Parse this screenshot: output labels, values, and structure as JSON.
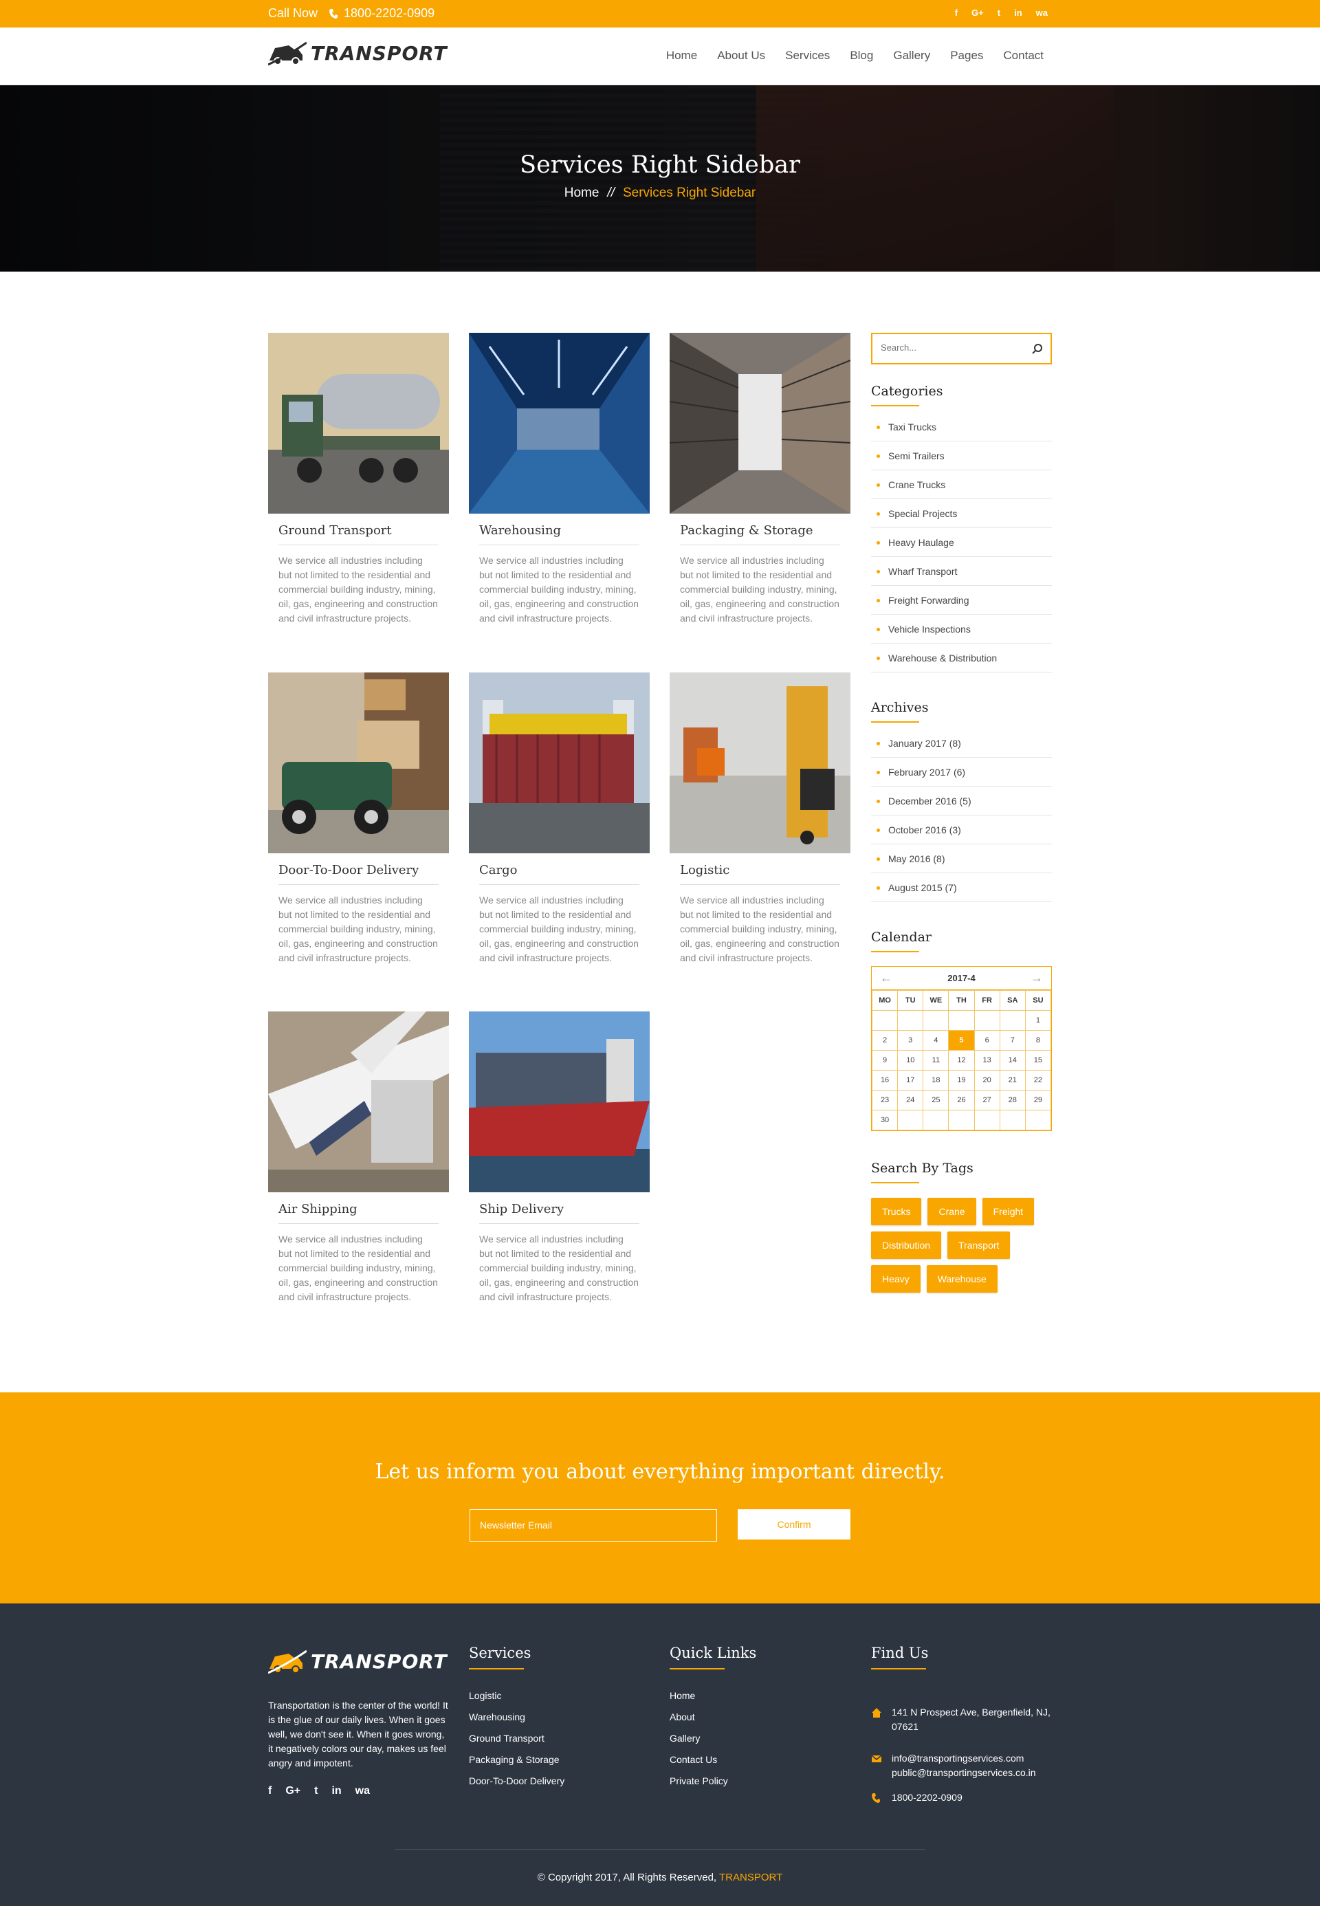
{
  "topbar": {
    "call_label": "Call Now",
    "phone": "1800-2202-0909",
    "socials": [
      "f",
      "G+",
      "t",
      "in",
      "wa"
    ]
  },
  "header": {
    "logo_text": "TRANSPORT",
    "nav": [
      "Home",
      "About Us",
      "Services",
      "Blog",
      "Gallery",
      "Pages",
      "Contact"
    ]
  },
  "hero": {
    "title": "Services Right Sidebar",
    "crumb_home": "Home",
    "crumb_sep": "//",
    "crumb_current": "Services Right Sidebar"
  },
  "services": [
    {
      "title": "Ground Transport",
      "text": "We service all industries including but not limited to the residential and commercial building industry, mining, oil, gas, engineering and construction and civil infrastructure projects."
    },
    {
      "title": "Warehousing",
      "text": "We service all industries including but not limited to the residential and commercial building industry, mining, oil, gas, engineering and construction and civil infrastructure projects."
    },
    {
      "title": "Packaging & Storage",
      "text": "We service all industries including but not limited to the residential and commercial building industry, mining, oil, gas, engineering and construction and civil infrastructure projects."
    },
    {
      "title": "Door-To-Door Delivery",
      "text": "We service all industries including but not limited to the residential and commercial building industry, mining, oil, gas, engineering and construction and civil infrastructure projects."
    },
    {
      "title": "Cargo",
      "text": "We service all industries including but not limited to the residential and commercial building industry, mining, oil, gas, engineering and construction and civil infrastructure projects."
    },
    {
      "title": "Logistic",
      "text": "We service all industries including but not limited to the residential and commercial building industry, mining, oil, gas, engineering and construction and civil infrastructure projects."
    },
    {
      "title": "Air Shipping",
      "text": "We service all industries including but not limited to the residential and commercial building industry, mining, oil, gas, engineering and construction and civil infrastructure projects."
    },
    {
      "title": "Ship Delivery",
      "text": "We service all industries including but not limited to the residential and commercial building industry, mining, oil, gas, engineering and construction and civil infrastructure projects."
    }
  ],
  "sidebar": {
    "search_placeholder": "Search...",
    "categories_title": "Categories",
    "categories": [
      "Taxi Trucks",
      "Semi Trailers",
      "Crane Trucks",
      "Special Projects",
      "Heavy Haulage",
      "Wharf Transport",
      "Freight Forwarding",
      "Vehicle Inspections",
      "Warehouse & Distribution"
    ],
    "archives_title": "Archives",
    "archives": [
      "January 2017 (8)",
      "February 2017 (6)",
      "December 2016 (5)",
      "October 2016 (3)",
      "May 2016 (8)",
      "August 2015 (7)"
    ],
    "calendar_title": "Calendar",
    "calendar": {
      "month": "2017-4",
      "prev": "←",
      "next": "→",
      "days": [
        "MO",
        "TU",
        "WE",
        "TH",
        "FR",
        "SA",
        "SU"
      ],
      "today": "5",
      "weeks": [
        [
          "",
          "",
          "",
          "",
          "",
          "",
          "1"
        ],
        [
          "2",
          "3",
          "4",
          "5",
          "6",
          "7",
          "8"
        ],
        [
          "9",
          "10",
          "11",
          "12",
          "13",
          "14",
          "15"
        ],
        [
          "16",
          "17",
          "18",
          "19",
          "20",
          "21",
          "22"
        ],
        [
          "23",
          "24",
          "25",
          "26",
          "27",
          "28",
          "29"
        ],
        [
          "30",
          "",
          "",
          "",
          "",
          "",
          ""
        ]
      ]
    },
    "tags_title": "Search By Tags",
    "tags": [
      "Trucks",
      "Crane",
      "Freight",
      "Distribution",
      "Transport",
      "Heavy",
      "Warehouse"
    ]
  },
  "newsletter": {
    "heading": "Let us inform you about everything important directly.",
    "placeholder": "Newsletter Email",
    "button": "Confirm"
  },
  "footer": {
    "logo_text": "TRANSPORT",
    "about": "Transportation is the center of the world! It is the glue of our daily lives. When it goes well, we don't see it. When it goes wrong, it negatively colors our day, makes us feel angry and impotent.",
    "socials": [
      "f",
      "G+",
      "t",
      "in",
      "wa"
    ],
    "services_title": "Services",
    "services": [
      "Logistic",
      "Warehousing",
      "Ground Transport",
      "Packaging & Storage",
      "Door-To-Door Delivery"
    ],
    "links_title": "Quick Links",
    "links": [
      "Home",
      "About",
      "Gallery",
      "Contact Us",
      "Private Policy"
    ],
    "find_title": "Find Us",
    "address": "141 N Prospect Ave, Bergenfield, NJ, 07621",
    "email1": "info@transportingservices.com",
    "email2": "public@transportingservices.co.in",
    "phone": "1800-2202-0909",
    "copyright": "© Copyright 2017, All Rights Reserved,",
    "brand": "TRANSPORT"
  },
  "colors": {
    "accent": "#f9a600",
    "footer_bg": "#2d3540"
  },
  "icons": [
    "phone-icon",
    "facebook-icon",
    "google-plus-icon",
    "twitter-icon",
    "linkedin-icon",
    "whatsapp-icon",
    "search-icon",
    "map-marker-icon",
    "envelope-icon"
  ]
}
